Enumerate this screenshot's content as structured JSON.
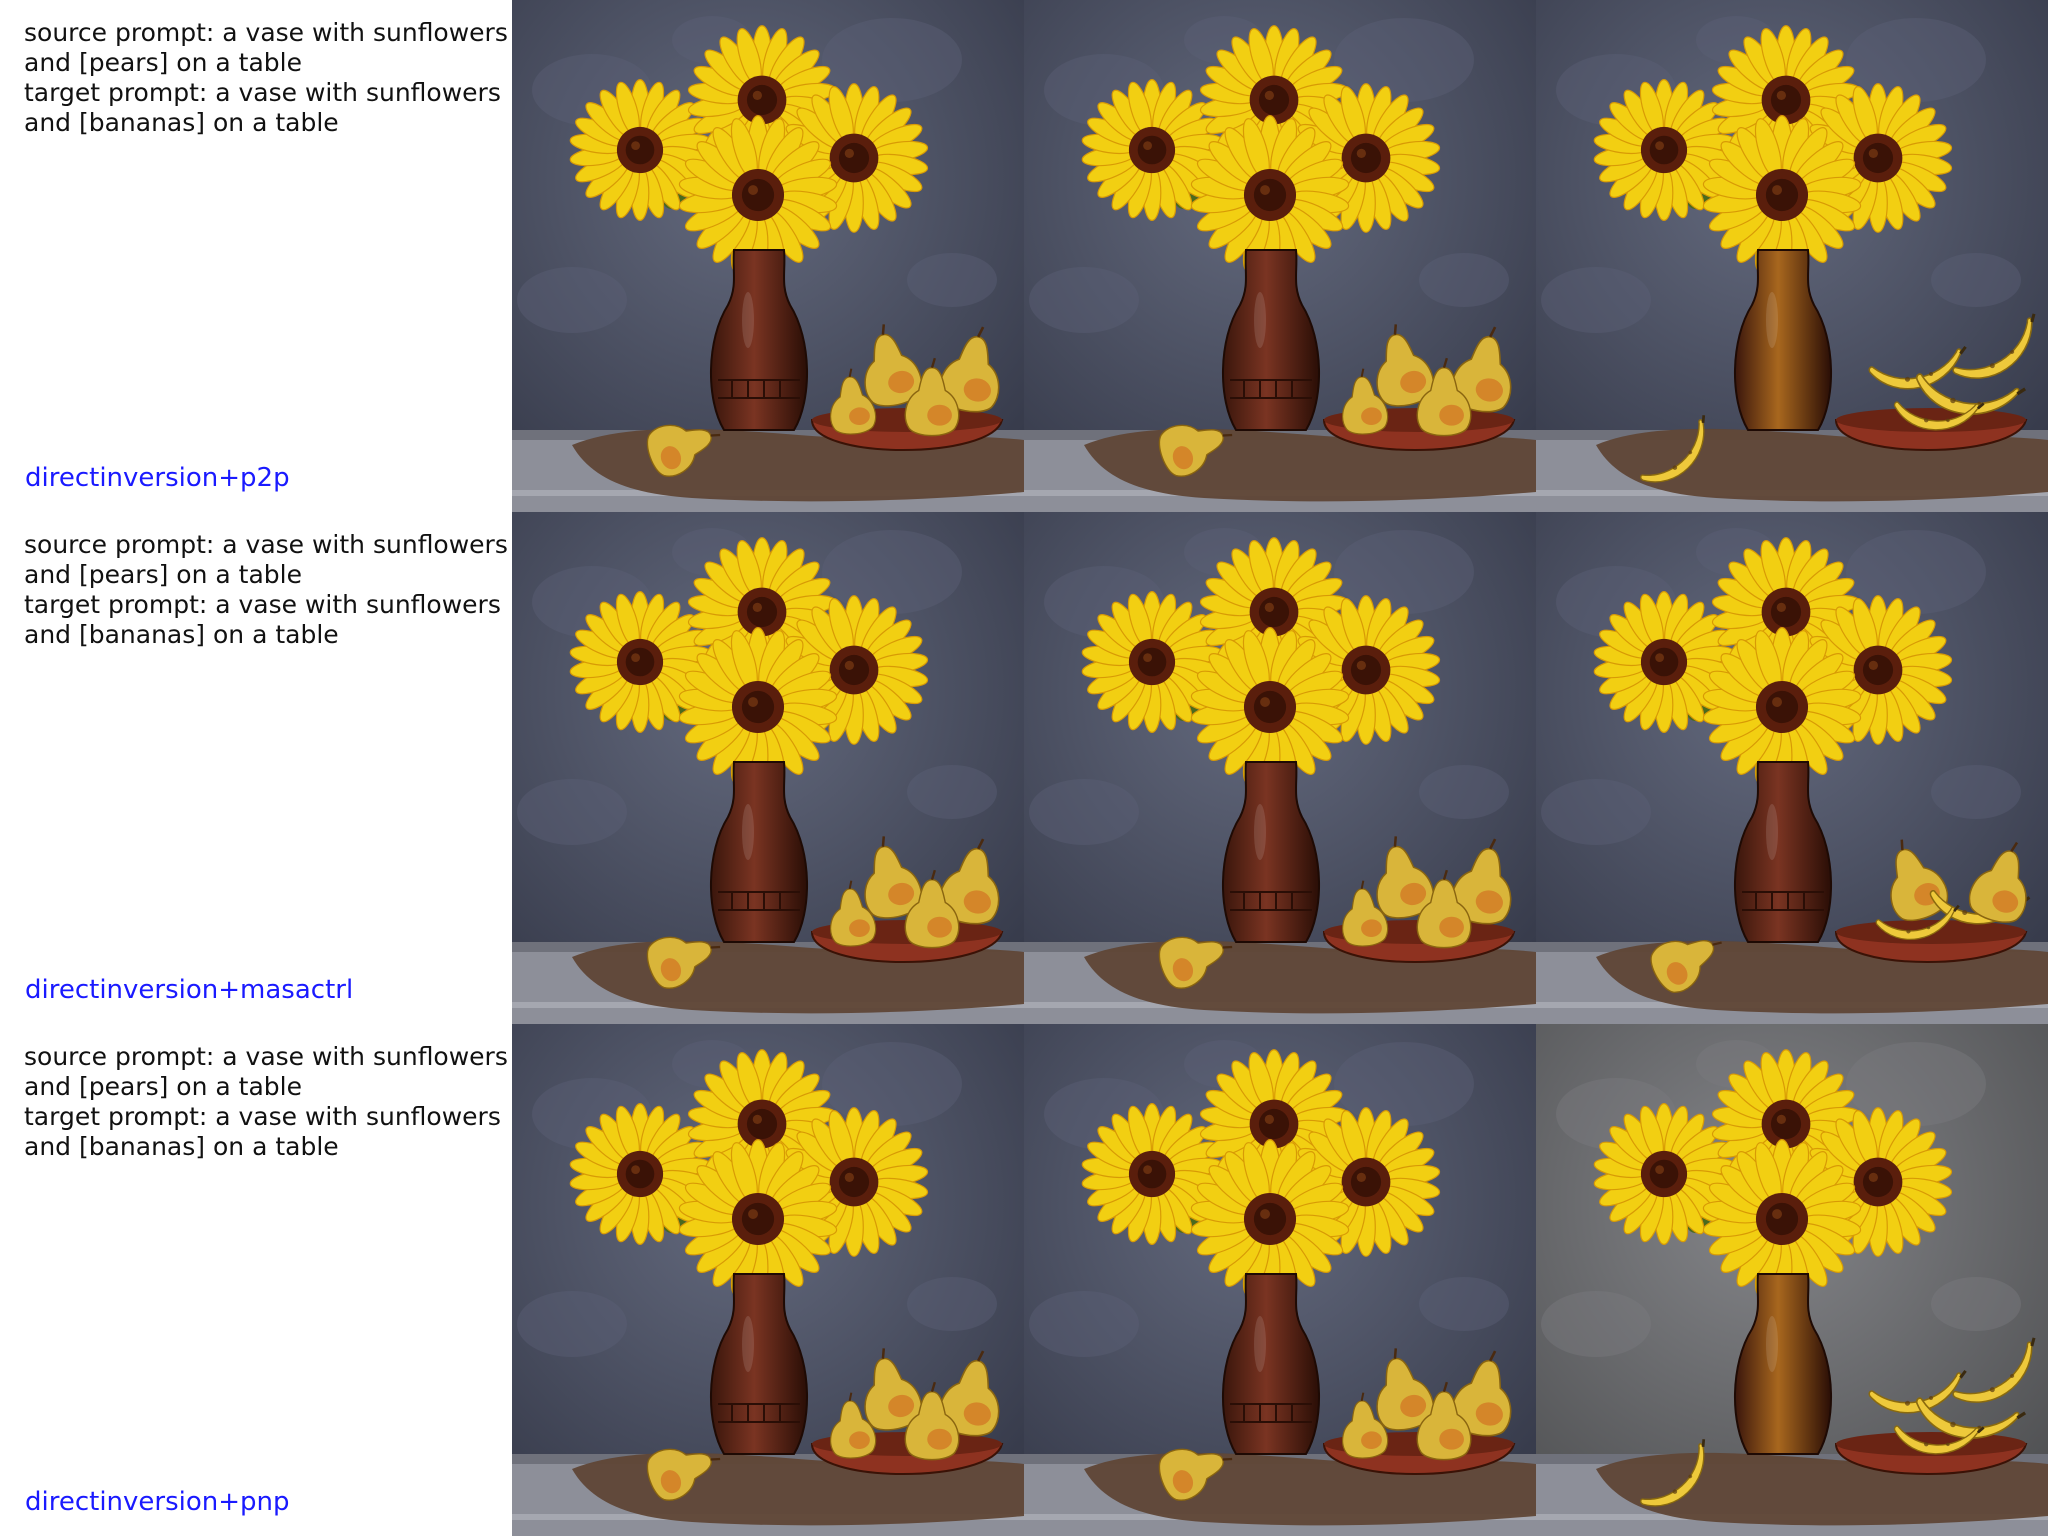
{
  "rows": [
    {
      "source_prompt_line1": "source prompt: a vase with sunflowers",
      "source_prompt_line2": "and [pears] on a table",
      "target_prompt_line1": "target prompt: a vase with sunflowers",
      "target_prompt_line2": "and [bananas] on a table",
      "method": "directinversion+p2p",
      "method_color": "#1a1aff",
      "images": [
        {
          "kind": "source",
          "fruit": "pears",
          "style": "painted"
        },
        {
          "kind": "reconstruction",
          "fruit": "pears",
          "style": "painted"
        },
        {
          "kind": "edited",
          "fruit": "bananas",
          "style": "painted"
        }
      ]
    },
    {
      "source_prompt_line1": "source prompt: a vase with sunflowers",
      "source_prompt_line2": "and [pears] on a table",
      "target_prompt_line1": "target prompt: a vase with sunflowers",
      "target_prompt_line2": "and [bananas] on a table",
      "method": "directinversion+masactrl",
      "method_color": "#1a1aff",
      "images": [
        {
          "kind": "source",
          "fruit": "pears",
          "style": "painted"
        },
        {
          "kind": "reconstruction",
          "fruit": "pears",
          "style": "painted"
        },
        {
          "kind": "edited",
          "fruit": "pears-bananas",
          "style": "painted"
        }
      ]
    },
    {
      "source_prompt_line1": "source prompt: a vase with sunflowers",
      "source_prompt_line2": "and [pears] on a table",
      "target_prompt_line1": "target prompt: a vase with sunflowers",
      "target_prompt_line2": "and [bananas] on a table",
      "method": "directinversion+pnp",
      "method_color": "#1a1aff",
      "images": [
        {
          "kind": "source",
          "fruit": "pears",
          "style": "painted"
        },
        {
          "kind": "reconstruction",
          "fruit": "pears",
          "style": "painted"
        },
        {
          "kind": "edited",
          "fruit": "bananas",
          "style": "photo"
        }
      ]
    }
  ],
  "palette": {
    "wall_painted": "#4e5467",
    "wall_photo": "#6e6f71",
    "petal": "#f2cf12",
    "petal_edge": "#d89a05",
    "flower_center": "#5a1e0c",
    "vase": "#7a3422",
    "vase_golden": "#a8671e",
    "pear": "#d9b53a",
    "pear_blush": "#d0671e",
    "banana": "#eec93b",
    "bowl": "#8e3220",
    "burlap": "#5f4636",
    "table": "#8d8f99"
  }
}
